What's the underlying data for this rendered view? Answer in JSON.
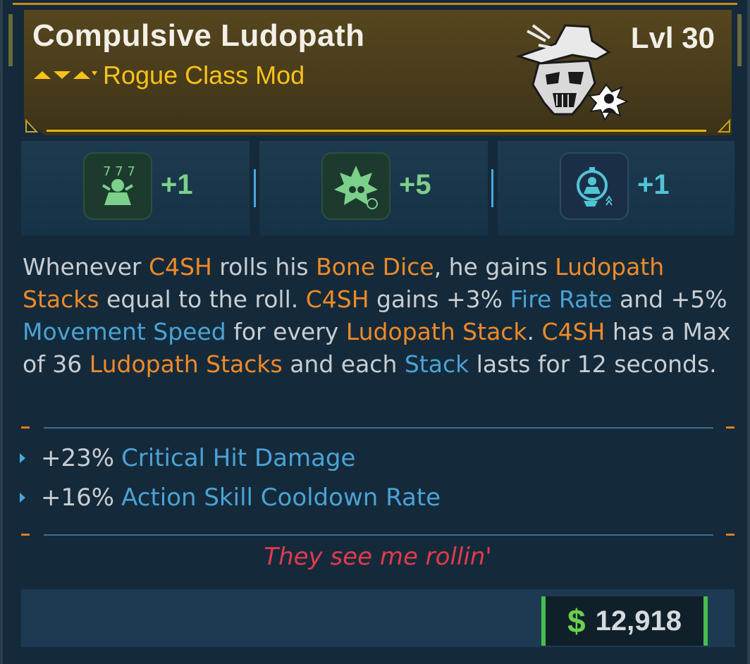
{
  "item": {
    "name": "Compulsive Ludopath",
    "type": "Rogue Class Mod",
    "level": "Lvl 30",
    "rarity_color": "#f7c21a"
  },
  "skills": [
    {
      "icon": "skill-dice-icon",
      "bonus": "+1",
      "color": "#7cd08a"
    },
    {
      "icon": "skill-leaf-timer-icon",
      "bonus": "+5",
      "color": "#7cd08a"
    },
    {
      "icon": "skill-target-figure-icon",
      "bonus": "+1",
      "color": "#52c4d6"
    }
  ],
  "description": {
    "parts": [
      {
        "t": "Whenever ",
        "c": "n"
      },
      {
        "t": "C4SH",
        "c": "o"
      },
      {
        "t": " rolls his ",
        "c": "n"
      },
      {
        "t": "Bone Dice",
        "c": "o"
      },
      {
        "t": ", he gains ",
        "c": "n"
      },
      {
        "t": "Ludopath Stacks",
        "c": "o"
      },
      {
        "t": " equal to the roll. ",
        "c": "n"
      },
      {
        "t": "C4SH",
        "c": "o"
      },
      {
        "t": " gains +3% ",
        "c": "n"
      },
      {
        "t": "Fire Rate",
        "c": "b"
      },
      {
        "t": " and +5% ",
        "c": "n"
      },
      {
        "t": "Movement Speed",
        "c": "b"
      },
      {
        "t": " for every ",
        "c": "n"
      },
      {
        "t": "Ludopath Stack",
        "c": "o"
      },
      {
        "t": ". ",
        "c": "n"
      },
      {
        "t": "C4SH",
        "c": "o"
      },
      {
        "t": " has a Max of 36 ",
        "c": "n"
      },
      {
        "t": "Ludopath Stacks",
        "c": "o"
      },
      {
        "t": " and each ",
        "c": "n"
      },
      {
        "t": "Stack",
        "c": "b"
      },
      {
        "t": " lasts for 12 seconds.",
        "c": "n"
      }
    ]
  },
  "stats": [
    {
      "value": "+23%",
      "name": "Critical Hit Damage"
    },
    {
      "value": "+16%",
      "name": "Action Skill Cooldown Rate"
    }
  ],
  "flavor_text": "They see me rollin'",
  "price": {
    "currency_symbol": "$",
    "amount": "12,918"
  }
}
